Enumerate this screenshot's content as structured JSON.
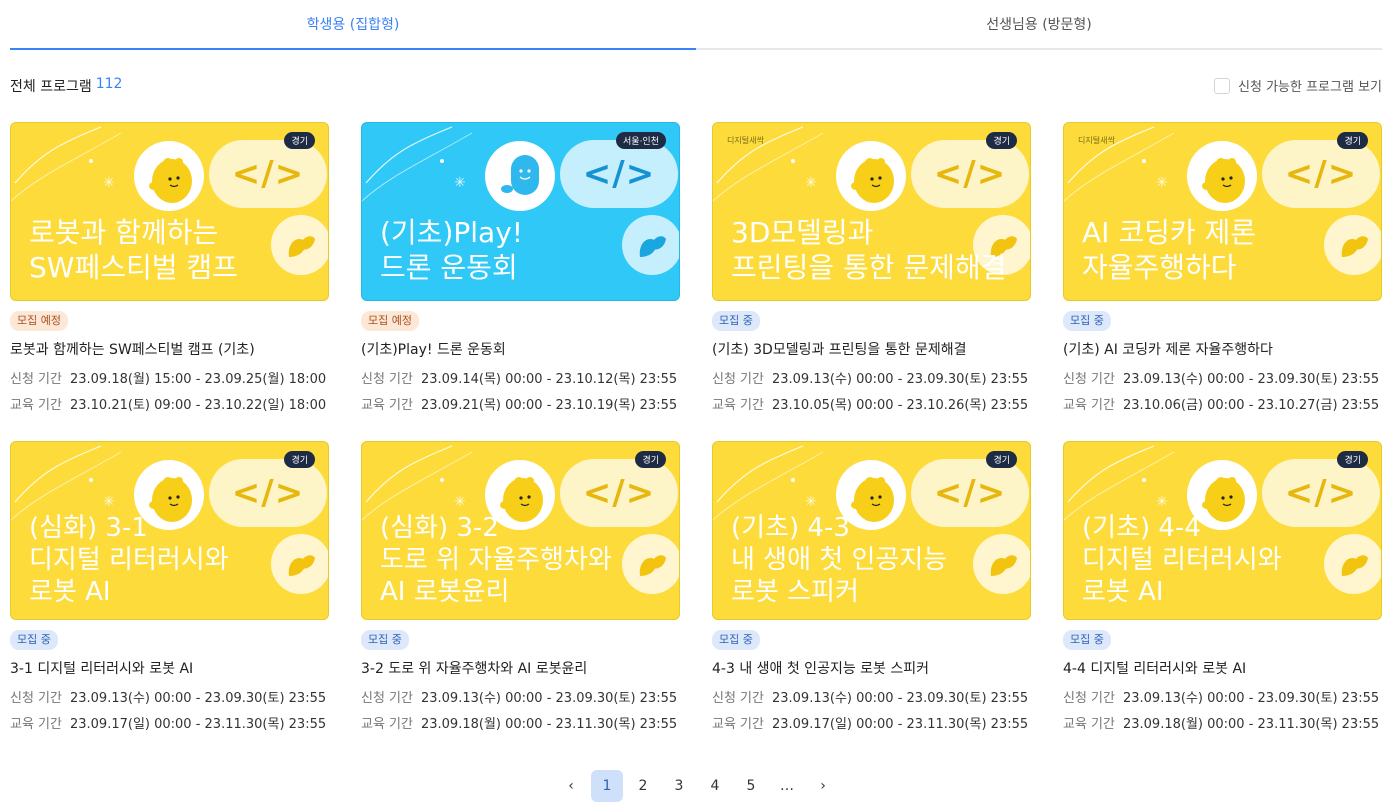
{
  "tabs": [
    {
      "label": "학생용 (집합형)",
      "active": true
    },
    {
      "label": "선생님용 (방문형)",
      "active": false
    }
  ],
  "summary": {
    "label": "전체 프로그램",
    "count": "112"
  },
  "filter": {
    "label": "신청 가능한 프로그램 보기"
  },
  "cards": [
    {
      "theme": "yellow",
      "region": "경기",
      "thumb_lines": [
        "로봇과 함께하는",
        "SW페스티벌 캠프"
      ],
      "status": "모집 예정",
      "status_type": "upcoming",
      "title": "로봇과 함께하는 SW페스티벌 캠프 (기초)",
      "apply_label": "신청 기간",
      "apply": "23.09.18(월) 15:00 - 23.09.25(월) 18:00",
      "edu_label": "교육 기간",
      "edu": "23.10.21(토) 09:00 - 23.10.22(일) 18:00"
    },
    {
      "theme": "blue",
      "region": "서울·인천",
      "thumb_lines": [
        "(기초)Play!",
        "드론 운동회"
      ],
      "status": "모집 예정",
      "status_type": "upcoming",
      "title": "(기초)Play! 드론 운동회",
      "apply_label": "신청 기간",
      "apply": "23.09.14(목) 00:00 - 23.10.12(목) 23:55",
      "edu_label": "교육 기간",
      "edu": "23.09.21(목) 00:00 - 23.10.19(목) 23:55"
    },
    {
      "theme": "yellow",
      "region": "경기",
      "brand": "디지털새싹",
      "thumb_lines": [
        "3D모델링과",
        "프린팅을 통한 문제해결"
      ],
      "status": "모집 중",
      "status_type": "open",
      "title": "(기초) 3D모델링과 프린팅을 통한 문제해결",
      "apply_label": "신청 기간",
      "apply": "23.09.13(수) 00:00 - 23.09.30(토) 23:55",
      "edu_label": "교육 기간",
      "edu": "23.10.05(목) 00:00 - 23.10.26(목) 23:55"
    },
    {
      "theme": "yellow",
      "region": "경기",
      "brand": "디지털새싹",
      "thumb_lines": [
        "AI 코딩카 제론",
        "자율주행하다"
      ],
      "status": "모집 중",
      "status_type": "open",
      "title": "(기초) AI 코딩카 제론 자율주행하다",
      "apply_label": "신청 기간",
      "apply": "23.09.13(수) 00:00 - 23.09.30(토) 23:55",
      "edu_label": "교육 기간",
      "edu": "23.10.06(금) 00:00 - 23.10.27(금) 23:55"
    },
    {
      "theme": "yellow",
      "region": "경기",
      "thumb_lines": [
        "(심화) 3-1",
        "디지털 리터러시와",
        "로봇 AI"
      ],
      "status": "모집 중",
      "status_type": "open",
      "title": "3-1 디지털 리터러시와 로봇 AI",
      "apply_label": "신청 기간",
      "apply": "23.09.13(수) 00:00 - 23.09.30(토) 23:55",
      "edu_label": "교육 기간",
      "edu": "23.09.17(일) 00:00 - 23.11.30(목) 23:55"
    },
    {
      "theme": "yellow",
      "region": "경기",
      "thumb_lines": [
        "(심화) 3-2",
        "도로 위 자율주행차와",
        "AI 로봇윤리"
      ],
      "status": "모집 중",
      "status_type": "open",
      "title": "3-2 도로 위 자율주행차와 AI 로봇윤리",
      "apply_label": "신청 기간",
      "apply": "23.09.13(수) 00:00 - 23.09.30(토) 23:55",
      "edu_label": "교육 기간",
      "edu": "23.09.18(월) 00:00 - 23.11.30(목) 23:55"
    },
    {
      "theme": "yellow",
      "region": "경기",
      "thumb_lines": [
        "(기초) 4-3",
        "내 생애 첫 인공지능",
        "로봇 스피커"
      ],
      "status": "모집 중",
      "status_type": "open",
      "title": "4-3 내 생애 첫 인공지능 로봇 스피커",
      "apply_label": "신청 기간",
      "apply": "23.09.13(수) 00:00 - 23.09.30(토) 23:55",
      "edu_label": "교육 기간",
      "edu": "23.09.17(일) 00:00 - 23.11.30(목) 23:55"
    },
    {
      "theme": "yellow",
      "region": "경기",
      "thumb_lines": [
        "(기초) 4-4",
        "디지털 리터러시와",
        "로봇 AI"
      ],
      "status": "모집 중",
      "status_type": "open",
      "title": "4-4 디지털 리터러시와 로봇 AI",
      "apply_label": "신청 기간",
      "apply": "23.09.13(수) 00:00 - 23.09.30(토) 23:55",
      "edu_label": "교육 기간",
      "edu": "23.09.18(월) 00:00 - 23.11.30(목) 23:55"
    }
  ],
  "thumb_code": "</>",
  "pagination": {
    "prev": "‹",
    "pages": [
      "1",
      "2",
      "3",
      "4",
      "5"
    ],
    "ellipsis": "…",
    "next": "›",
    "current": "1"
  },
  "colors": {
    "accent": "#3b82f6",
    "yellow": "#fddb3a",
    "blue": "#2fc8f7"
  }
}
